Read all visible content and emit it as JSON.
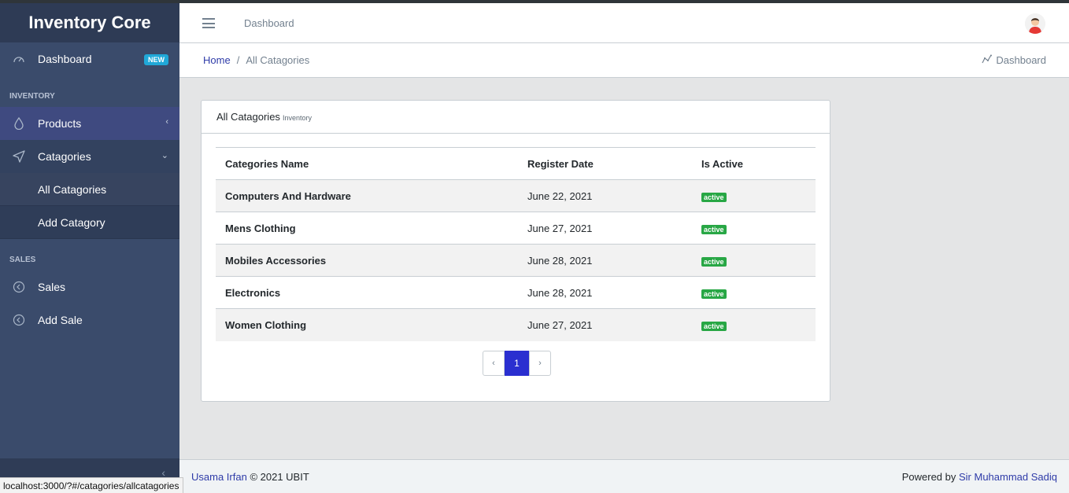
{
  "app": {
    "title": "Inventory Core"
  },
  "sidebar": {
    "dashboard": {
      "label": "Dashboard",
      "badge": "NEW",
      "icon": "speedometer-icon"
    },
    "sections": {
      "inventory": "INVENTORY",
      "sales": "SALES"
    },
    "products": {
      "label": "Products",
      "icon": "drop-icon"
    },
    "categories": {
      "label": "Catagories",
      "icon": "paper-plane-icon",
      "children": [
        "All Catagories",
        "Add Catagory"
      ]
    },
    "sales_items": [
      {
        "label": "Sales",
        "icon": "clock-back-icon"
      },
      {
        "label": "Add Sale",
        "icon": "clock-back-icon"
      }
    ]
  },
  "header": {
    "link": "Dashboard"
  },
  "breadcrumb": {
    "home": "Home",
    "separator": "/",
    "current": "All Catagories",
    "right_link": "Dashboard"
  },
  "card": {
    "title": "All Catagories",
    "subtitle": "Inventory",
    "columns": [
      "Categories Name",
      "Register Date",
      "Is Active"
    ],
    "rows": [
      {
        "name": "Computers And Hardware",
        "date": "June 22, 2021",
        "status": "active"
      },
      {
        "name": "Mens Clothing",
        "date": "June 27, 2021",
        "status": "active"
      },
      {
        "name": "Mobiles Accessories",
        "date": "June 28, 2021",
        "status": "active"
      },
      {
        "name": "Electronics",
        "date": "June 28, 2021",
        "status": "active"
      },
      {
        "name": "Women Clothing",
        "date": "June 27, 2021",
        "status": "active"
      }
    ],
    "pagination": {
      "prev": "‹",
      "current": "1",
      "next": "›"
    }
  },
  "footer": {
    "author": "Usama Irfan",
    "copyright": "© 2021 UBIT",
    "powered_prefix": "Powered by",
    "powered_name": "Sir Muhammad Sadiq"
  },
  "status_url": "localhost:3000/?#/catagories/allcatagories",
  "colors": {
    "sidebar": "#3a4b6b",
    "brand_bg": "#2e3b55",
    "accent": "#2a2fd0",
    "badge_new": "#20a8d8",
    "status_active": "#28a745"
  }
}
